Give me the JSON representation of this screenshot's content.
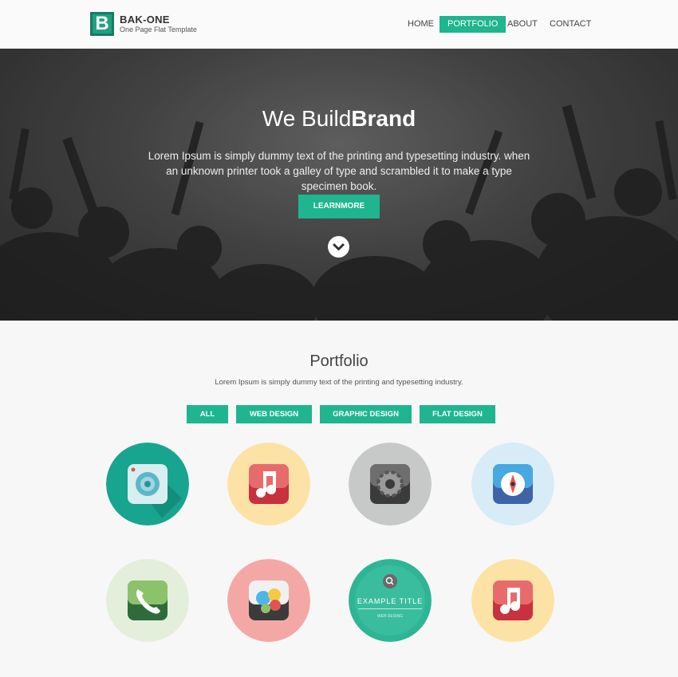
{
  "header": {
    "logo_letter": "B",
    "brand_name": "BAK-ONE",
    "tagline": "One Page Flat Template",
    "nav": [
      {
        "label": "HOME",
        "active": false
      },
      {
        "label": "PORTFOLIO",
        "active": true
      },
      {
        "label": "ABOUT",
        "active": false
      },
      {
        "label": "CONTACT",
        "active": false
      }
    ]
  },
  "hero": {
    "title_light": "We Build",
    "title_bold": "Brand",
    "text": "Lorem Ipsum is simply dummy text of the printing and typesetting industry. when an unknown printer took a galley of type and scrambled it to make a type specimen book.",
    "button_label": "LEARNMORE",
    "scroll_icon": "chevron-down-icon"
  },
  "portfolio": {
    "title": "Portfolio",
    "subtitle": "Lorem Ipsum is simply dummy text of the printing and typesetting industry.",
    "filters": [
      "ALL",
      "WEB DESIGN",
      "GRAPHIC DESIGN",
      "FLAT DESIGN"
    ],
    "items": [
      {
        "icon": "camera-icon",
        "bg": "#17a590"
      },
      {
        "icon": "music-icon",
        "bg": "#fce3a5"
      },
      {
        "icon": "settings-icon",
        "bg": "#c7c8c8"
      },
      {
        "icon": "compass-icon",
        "bg": "#d7ecf6"
      },
      {
        "icon": "phone-icon",
        "bg": "#e3eedb"
      },
      {
        "icon": "game-center-icon",
        "bg": "#f4a8a6"
      },
      {
        "icon": "search-icon",
        "bg": "#2eb596",
        "hover_title": "EXAMPLE TITLE",
        "hover_caption": "WEB DESING"
      },
      {
        "icon": "music-icon",
        "bg": "#fce3a5"
      }
    ]
  },
  "colors": {
    "accent": "#1fb58f",
    "logo_dark": "#1a7a62"
  }
}
